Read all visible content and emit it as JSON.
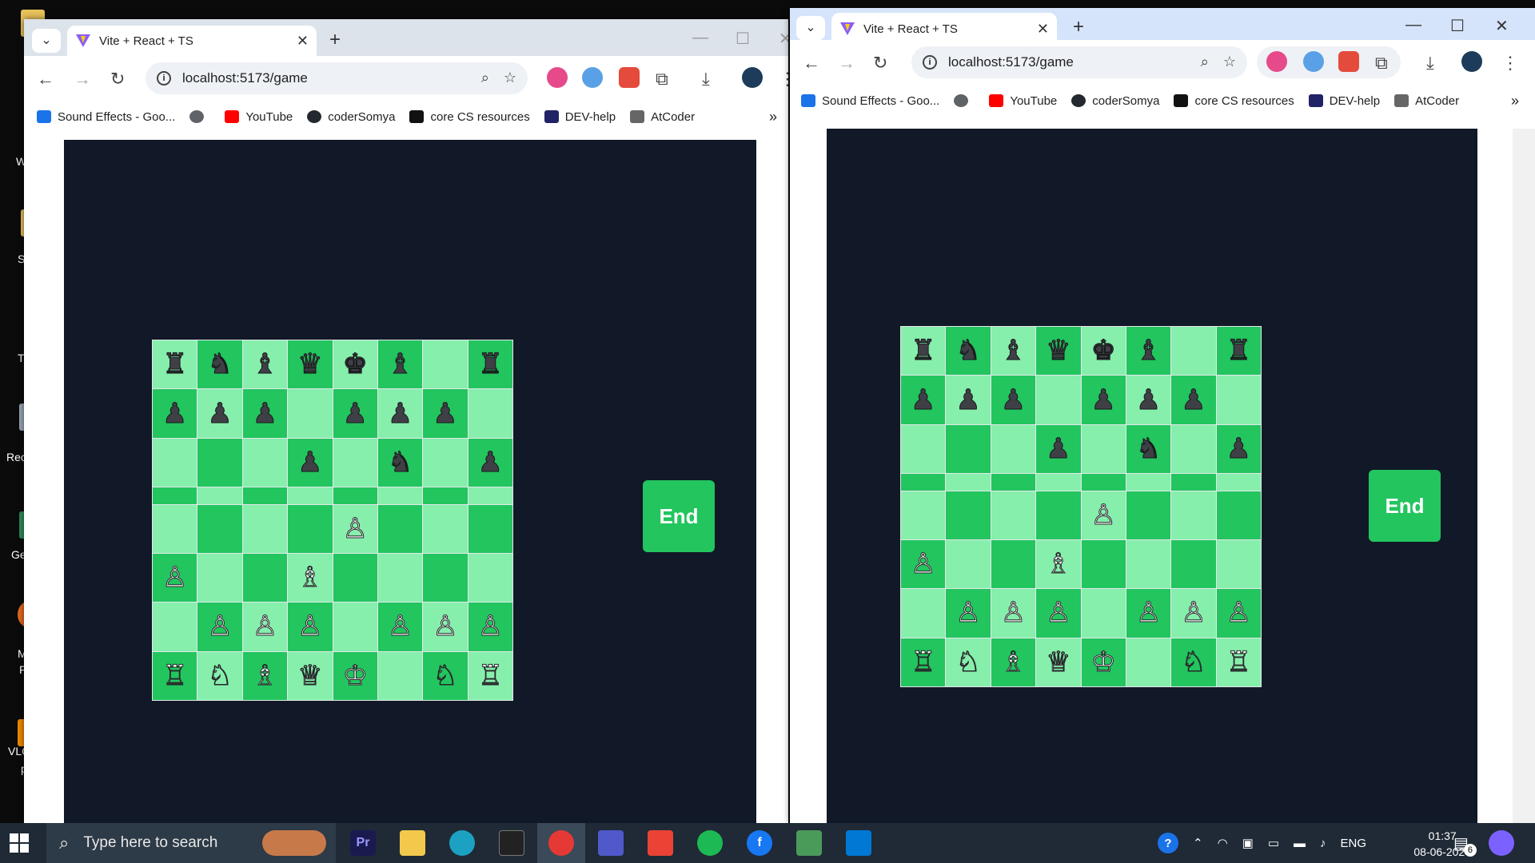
{
  "desktop": {
    "labels": [
      "W",
      "S",
      "T",
      "Rec",
      "Ge",
      "M",
      "F",
      "VLC",
      "p"
    ]
  },
  "left_window": {
    "tab_title": "Vite + React + TS",
    "url": "localhost:5173/game",
    "end_label": "End"
  },
  "right_window": {
    "tab_title": "Vite + React + TS",
    "url": "localhost:5173/game",
    "end_label": "End"
  },
  "bookmarks": [
    {
      "label": "Sound Effects - Goo...",
      "icon": "google-drive-icon",
      "color": "#1a73e8"
    },
    {
      "label": "",
      "icon": "globe-icon",
      "color": "#5f6368"
    },
    {
      "label": "YouTube",
      "icon": "youtube-icon",
      "color": "#ff0000"
    },
    {
      "label": "coderSomya",
      "icon": "github-icon",
      "color": "#24292f"
    },
    {
      "label": "core CS resources",
      "icon": "medium-icon",
      "color": "#111111"
    },
    {
      "label": "DEV-help",
      "icon": "dev-icon",
      "color": "#222266"
    },
    {
      "label": "AtCoder",
      "icon": "atcoder-icon",
      "color": "#666666"
    }
  ],
  "board": {
    "rows": [
      [
        "♜",
        "♞",
        "♝",
        "♛",
        "♚",
        "♝",
        "",
        "♜"
      ],
      [
        "♟",
        "♟",
        "♟",
        "",
        "♟",
        "♟",
        "♟",
        ""
      ],
      [
        "",
        "",
        "",
        "♟",
        "",
        "♞",
        "",
        "♟"
      ],
      [
        "",
        "",
        "",
        "",
        "",
        "",
        "",
        ""
      ],
      [
        "",
        "",
        "",
        "",
        "♙",
        "",
        "",
        ""
      ],
      [
        "♙",
        "",
        "",
        "♗",
        "",
        "",
        "",
        ""
      ],
      [
        "",
        "♙",
        "♙",
        "♙",
        "",
        "♙",
        "♙",
        "♙"
      ],
      [
        "♖",
        "♘",
        "♗",
        "♕",
        "♔",
        "",
        "♘",
        "♖"
      ]
    ]
  },
  "colors": {
    "light_square": "#86efac",
    "dark_square": "#22c55e",
    "page_bg": "#111827",
    "button": "#22c55e"
  },
  "taskbar": {
    "search_placeholder": "Type here to search",
    "language": "ENG",
    "time": "01:37",
    "date": "08-06-2024",
    "notification_count": "6",
    "apps": [
      "premiere-pro-icon",
      "file-explorer-icon",
      "edge-icon",
      "terminal-icon",
      "chrome-icon",
      "teams-icon",
      "gmail-icon",
      "spotify-icon",
      "facebook-icon",
      "git-icon",
      "vscode-icon"
    ]
  }
}
